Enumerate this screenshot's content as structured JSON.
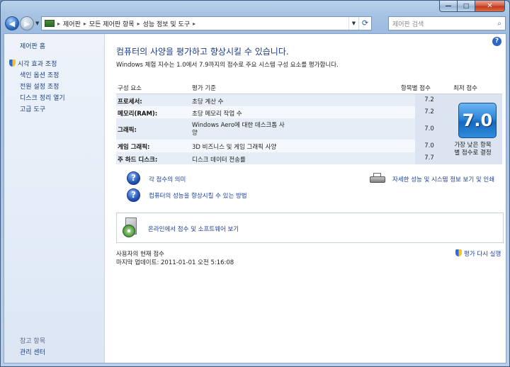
{
  "window": {
    "caption_buttons": {
      "minimize": "—",
      "maximize": "□",
      "close": "✕"
    }
  },
  "nav": {
    "back_glyph": "◀",
    "forward_glyph": "▶",
    "breadcrumbs": [
      "제어판",
      "모든 제어판 항목",
      "성능 정보 및 도구"
    ],
    "breadcrumb_separator": "▸",
    "search_placeholder": "제어판 검색",
    "search_icon": "magnifier-icon",
    "refresh_icon": "refresh-icon"
  },
  "sidebar": {
    "home": "제어판 홈",
    "items": [
      {
        "label": "시각 효과 조정",
        "shield": true
      },
      {
        "label": "색인 옵션 조정",
        "shield": false
      },
      {
        "label": "전원 설정 조정",
        "shield": false
      },
      {
        "label": "디스크 정리 열기",
        "shield": false
      },
      {
        "label": "고급 도구",
        "shield": false
      }
    ],
    "see_also": "참고 항목",
    "see_also_items": [
      "관리 센터"
    ]
  },
  "main": {
    "heading": "컴퓨터의 사양을 평가하고 향상시킬 수 있습니다.",
    "intro": "Windows 체험 지수는 1.0에서 7.9까지의 점수로 주요 시스템 구성 요소를 평가합니다.",
    "table": {
      "headers": {
        "component": "구성 요소",
        "rated": "평가 기준",
        "subscore": "항목별 점수",
        "base": "최저 점수"
      },
      "rows": [
        {
          "component": "프로세서:",
          "description": "초당 계산 수",
          "score": "7.2"
        },
        {
          "component": "메모리(RAM):",
          "description": "초당 메모리 작업 수",
          "score": "7.2"
        },
        {
          "component": "그래픽:",
          "description": "Windows Aero에 대한 데스크톱 사",
          "description2": "양",
          "score": "7.0"
        },
        {
          "component": "게임 그래픽:",
          "description": "3D 비즈니스 및 게임 그래픽 사양",
          "score": "7.0"
        },
        {
          "component": "주 하드 디스크:",
          "description": "디스크 데이터 전송률",
          "score": "7.7"
        }
      ],
      "base_score": "7.0",
      "base_caption_1": "가장 낮은 항목",
      "base_caption_2": "별 점수로 결정"
    },
    "links": {
      "meaning": "각 점수의 의미",
      "improve": "컴퓨터의 성능을 향상시킬 수 있는 방법",
      "details": "자세한 성능 및 시스템 정보 보기 및 인쇄",
      "online": "온라인에서 점수 및 소프트웨어 보기",
      "question_glyph": "?"
    },
    "status": {
      "current": "사용자의 현재 점수",
      "last_update": "마지막 업데이트: 2011-01-01 오전 5:16:08",
      "rerun": "평가 다시 실행"
    },
    "help_glyph": "?"
  }
}
